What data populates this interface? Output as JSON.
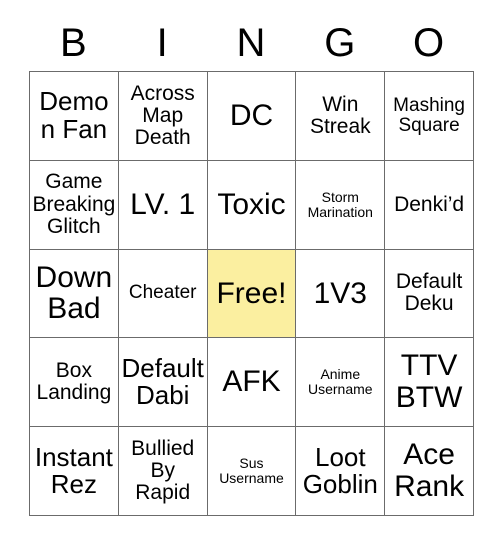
{
  "card": {
    "header_letters": [
      "B",
      "I",
      "N",
      "G",
      "O"
    ],
    "free_space_color": "#fbefa0",
    "border_color": "#6b6b6b",
    "rows": [
      [
        {
          "text": "Demon Fan",
          "size": "fs-lg",
          "free": false
        },
        {
          "text": "Across Map Death",
          "size": "fs-md",
          "free": false
        },
        {
          "text": "DC",
          "size": "fs-xl",
          "free": false
        },
        {
          "text": "Win Streak",
          "size": "fs-md",
          "free": false
        },
        {
          "text": "Mashing Square",
          "size": "fs-sm",
          "free": false
        }
      ],
      [
        {
          "text": "Game Breaking Glitch",
          "size": "fs-md",
          "free": false
        },
        {
          "text": "LV. 1",
          "size": "fs-xl",
          "free": false
        },
        {
          "text": "Toxic",
          "size": "fs-xl",
          "free": false
        },
        {
          "text": "Storm Marination",
          "size": "fs-xs",
          "free": false
        },
        {
          "text": "Denki’d",
          "size": "fs-md",
          "free": false
        }
      ],
      [
        {
          "text": "Down Bad",
          "size": "fs-xl",
          "free": false
        },
        {
          "text": "Cheater",
          "size": "fs-sm",
          "free": false
        },
        {
          "text": "Free!",
          "size": "fs-xl",
          "free": true
        },
        {
          "text": "1V3",
          "size": "fs-xl",
          "free": false
        },
        {
          "text": "Default Deku",
          "size": "fs-md",
          "free": false
        }
      ],
      [
        {
          "text": "Box Landing",
          "size": "fs-md",
          "free": false
        },
        {
          "text": "Default Dabi",
          "size": "fs-lg",
          "free": false
        },
        {
          "text": "AFK",
          "size": "fs-xl",
          "free": false
        },
        {
          "text": "Anime Username",
          "size": "fs-xs",
          "free": false
        },
        {
          "text": "TTV BTW",
          "size": "fs-xl",
          "free": false
        }
      ],
      [
        {
          "text": "Instant Rez",
          "size": "fs-lg",
          "free": false
        },
        {
          "text": "Bullied By Rapid",
          "size": "fs-md",
          "free": false
        },
        {
          "text": "Sus Username",
          "size": "fs-xs",
          "free": false
        },
        {
          "text": "Loot Goblin",
          "size": "fs-lg",
          "free": false
        },
        {
          "text": "Ace Rank",
          "size": "fs-xl",
          "free": false
        }
      ]
    ]
  }
}
